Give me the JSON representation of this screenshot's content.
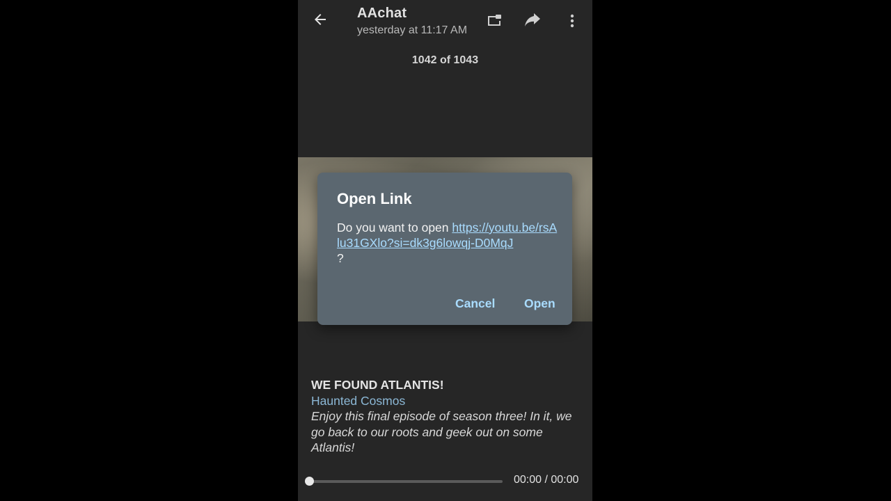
{
  "header": {
    "title": "AAchat",
    "subtitle": "yesterday at 11:17 AM",
    "back_icon": "arrow-back-icon",
    "pip_icon": "picture-in-picture-icon",
    "share_icon": "share-forward-icon",
    "more_icon": "more-vertical-icon"
  },
  "media_counter": "1042 of 1043",
  "dialog": {
    "title": "Open Link",
    "body_prefix": "Do you want to open ",
    "link_text": "https://youtu.be/rsAlu31GXlo?si=dk3g6lowqj-D0MqJ",
    "body_suffix": "?",
    "cancel_label": "Cancel",
    "open_label": "Open",
    "accent_color": "#a9dcff",
    "background_color": "#5b6770"
  },
  "caption": {
    "title": "WE FOUND ATLANTIS!",
    "channel": "Haunted Cosmos",
    "description": "Enjoy this final episode of season three! In it, we go back to our roots and geek out on some Atlantis!"
  },
  "player": {
    "time_display": "00:00 / 00:00",
    "progress": 0
  }
}
